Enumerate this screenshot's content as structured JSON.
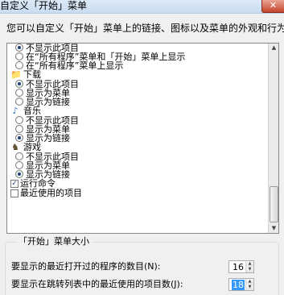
{
  "window": {
    "title": "自定义「开始」菜单",
    "close_glyph": "✕"
  },
  "intro": "您可以自定义「开始」菜单上的链接、图标以及菜单的外观和行为。",
  "options_list": {
    "top_options": [
      {
        "label": "不显示此项目",
        "selected": true
      },
      {
        "label": "在“所有程序”菜单和「开始」菜单上显示",
        "selected": false
      },
      {
        "label": "在“所有程序”菜单上显示",
        "selected": false
      }
    ],
    "categories": [
      {
        "label": "下载",
        "icon": "download-folder-icon",
        "icon_glyph": "📁",
        "options": [
          {
            "label": "不显示此项目",
            "selected": true
          },
          {
            "label": "显示为菜单",
            "selected": false
          },
          {
            "label": "显示为链接",
            "selected": false
          }
        ]
      },
      {
        "label": "音乐",
        "icon": "music-note-icon",
        "icon_glyph": "♪",
        "options": [
          {
            "label": "不显示此项目",
            "selected": false
          },
          {
            "label": "显示为菜单",
            "selected": false
          },
          {
            "label": "显示为链接",
            "selected": true
          }
        ]
      },
      {
        "label": "游戏",
        "icon": "games-icon",
        "icon_glyph": "♞",
        "options": [
          {
            "label": "不显示此项目",
            "selected": false
          },
          {
            "label": "显示为菜单",
            "selected": false
          },
          {
            "label": "显示为链接",
            "selected": true
          }
        ]
      }
    ],
    "checkboxes": [
      {
        "label": "运行命令",
        "checked": true
      },
      {
        "label": "最近使用的项目",
        "checked": false
      }
    ]
  },
  "size_group": {
    "title": "「开始」菜单大小",
    "recent_programs_label": "要显示的最近打开过的程序的数目(N):",
    "recent_programs_value": "16",
    "jump_list_label": "要显示在跳转列表中的最近使用的项目数(J):",
    "jump_list_value": "18"
  }
}
